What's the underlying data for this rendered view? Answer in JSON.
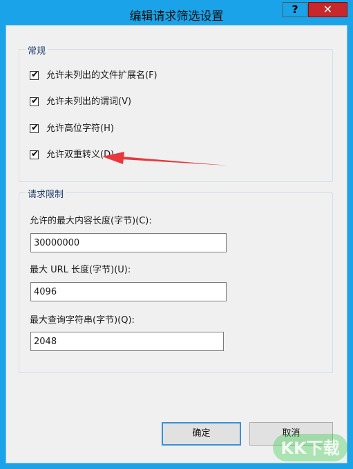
{
  "window": {
    "title": "编辑请求筛选设置",
    "help_glyph": "?",
    "close_glyph": "✕"
  },
  "general": {
    "title": "常规",
    "options": [
      {
        "label": "允许未列出的文件扩展名(F)",
        "checked": true
      },
      {
        "label": "允许未列出的谓词(V)",
        "checked": true
      },
      {
        "label": "允许高位字符(H)",
        "checked": true
      },
      {
        "label": "允许双重转义(D)",
        "checked": true
      }
    ]
  },
  "limits": {
    "title": "请求限制",
    "max_content_label": "允许的最大内容长度(字节)(C):",
    "max_content_value": "30000000",
    "max_url_label": "最大 URL 长度(字节)(U):",
    "max_url_value": "4096",
    "max_query_label": "最大查询字符串(字节)(Q):",
    "max_query_value": "2048"
  },
  "buttons": {
    "ok": "确定",
    "cancel": "取消"
  },
  "check_glyph": "✔",
  "watermark_text": "KK下载",
  "colors": {
    "titlebar": "#1aa3e8",
    "close": "#c6282b",
    "arrow": "#e8383d",
    "watermark": "#2ecc40"
  }
}
